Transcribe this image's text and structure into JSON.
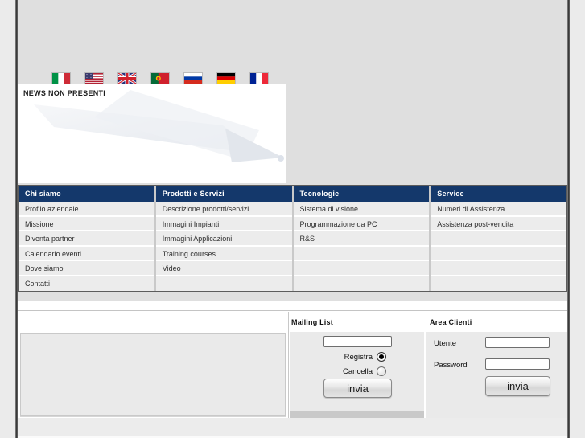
{
  "window": {
    "outer_bg": "#ebebeb",
    "page_bg": "#dfdfdf",
    "frame_color": "#2f2f2f"
  },
  "language_bar": {
    "flags": [
      {
        "name": "italy"
      },
      {
        "name": "usa"
      },
      {
        "name": "uk"
      },
      {
        "name": "portugal"
      },
      {
        "name": "russia"
      },
      {
        "name": "germany"
      },
      {
        "name": "france"
      }
    ]
  },
  "news": {
    "message": "NEWS NON PRESENTI"
  },
  "menu": {
    "colors": {
      "header_bg": "#14386b",
      "header_text": "#ffffff",
      "cell_bg": "#ececec"
    },
    "columns": [
      {
        "header": "Chi siamo",
        "items": [
          "Profilo aziendale",
          "Missione",
          "Diventa partner",
          "Calendario eventi",
          "Dove siamo",
          "Contatti"
        ]
      },
      {
        "header": "Prodotti e Servizi",
        "items": [
          "Descrizione prodotti/servizi",
          "Immagini Impianti",
          "Immagini Applicazioni",
          "Training courses",
          "Video",
          ""
        ]
      },
      {
        "header": "Tecnologie",
        "items": [
          "Sistema di visione",
          "Programmazione da PC",
          "R&S",
          "",
          "",
          ""
        ]
      },
      {
        "header": "Service",
        "items": [
          "Numeri di Assistenza",
          "Assistenza post-vendita",
          "",
          "",
          "",
          ""
        ]
      }
    ]
  },
  "mailing_list": {
    "title": "Mailing List",
    "email_value": "",
    "register_label": "Registra",
    "register_selected": true,
    "cancel_label": "Cancella",
    "cancel_selected": false,
    "submit_label": "invia"
  },
  "area_clienti": {
    "title": "Area Clienti",
    "user_label": "Utente",
    "user_value": "",
    "password_label": "Password",
    "password_value": "",
    "submit_label": "invia"
  }
}
